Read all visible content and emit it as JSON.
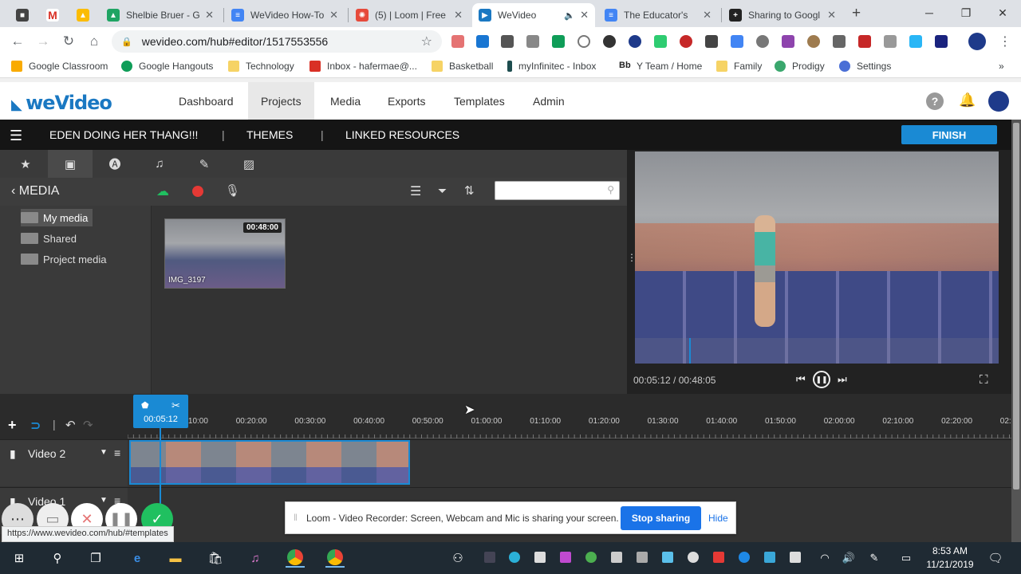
{
  "tabs": [
    {
      "title": "",
      "icon": "windows-icon",
      "color": "#444"
    },
    {
      "title": "",
      "icon": "gmail-icon",
      "color": "#d93025"
    },
    {
      "title": "",
      "icon": "drive-icon",
      "color": "#fbbc04"
    },
    {
      "title": "Shelbie Bruer - G",
      "icon": "drive-icon",
      "color": "#1fa463"
    },
    {
      "title": "WeVideo How-To",
      "icon": "docs-icon",
      "color": "#4285f4"
    },
    {
      "title": "(5) | Loom | Free",
      "icon": "loom-icon",
      "color": "#e64a3b"
    },
    {
      "title": "WeVideo",
      "icon": "wevideo-icon",
      "color": "#1a78c2"
    },
    {
      "title": "The Educator's",
      "icon": "docs-icon",
      "color": "#4285f4"
    },
    {
      "title": "Sharing to Googl",
      "icon": "plus-icon",
      "color": "#222"
    }
  ],
  "address": {
    "url": "wevideo.com/hub#editor/1517553556"
  },
  "bookmarks": [
    {
      "label": "Google Classroom",
      "color": "#f9ab00"
    },
    {
      "label": "Google Hangouts",
      "color": "#0f9d58"
    },
    {
      "label": "Technology",
      "color": "#f6d365"
    },
    {
      "label": "Inbox - hafermae@...",
      "color": "#d93025"
    },
    {
      "label": "Basketball",
      "color": "#f6d365"
    },
    {
      "label": "myInfinitec - Inbox",
      "color": "#1d4d4f"
    },
    {
      "label": "Y Team / Home",
      "color": "#222"
    },
    {
      "label": "Family",
      "color": "#f6d365"
    },
    {
      "label": "Prodigy",
      "color": "#3aa76d"
    },
    {
      "label": "Settings",
      "color": "#4a6fd6"
    }
  ],
  "bookmarks_more": "»",
  "wevideo": {
    "logo": "weVideo",
    "nav": [
      "Dashboard",
      "Projects",
      "Media",
      "Exports",
      "Templates",
      "Admin"
    ]
  },
  "editor": {
    "project_title": "EDEN DOING HER THANG!!!",
    "separator": "|",
    "themes": "THEMES",
    "linked": "LINKED RESOURCES",
    "finish": "FINISH"
  },
  "media": {
    "title": "MEDIA",
    "folders": [
      "My media",
      "Shared",
      "Project media"
    ],
    "clip": {
      "duration": "00:48:00",
      "name": "IMG_3197"
    }
  },
  "preview": {
    "time": "00:05:12 / 00:48:05"
  },
  "timeline": {
    "playhead": "00:05:12",
    "ticks": [
      "00:10:00",
      "00:20:00",
      "00:30:00",
      "00:40:00",
      "00:50:00",
      "01:00:00",
      "01:10:00",
      "01:20:00",
      "01:30:00",
      "01:40:00",
      "01:50:00",
      "02:00:00",
      "02:10:00",
      "02:20:00",
      "02:3"
    ],
    "tick_visible_prefix": [
      "",
      "",
      "",
      "",
      "",
      "",
      "",
      "",
      "",
      "",
      "",
      "",
      "",
      "",
      ""
    ],
    "tracks": [
      "Video 2",
      "Video 1"
    ]
  },
  "loom": {
    "message": "Loom - Video Recorder: Screen, Webcam and Mic is sharing your screen.",
    "stop": "Stop sharing",
    "hide": "Hide"
  },
  "status_url": "https://www.wevideo.com/hub/#templates",
  "clock": {
    "time": "8:53 AM",
    "date": "11/21/2019"
  },
  "colors": {
    "accent": "#1a8ad4",
    "record": "#e53935",
    "upload": "#20c060",
    "loom_stop": "#1a73e8"
  }
}
